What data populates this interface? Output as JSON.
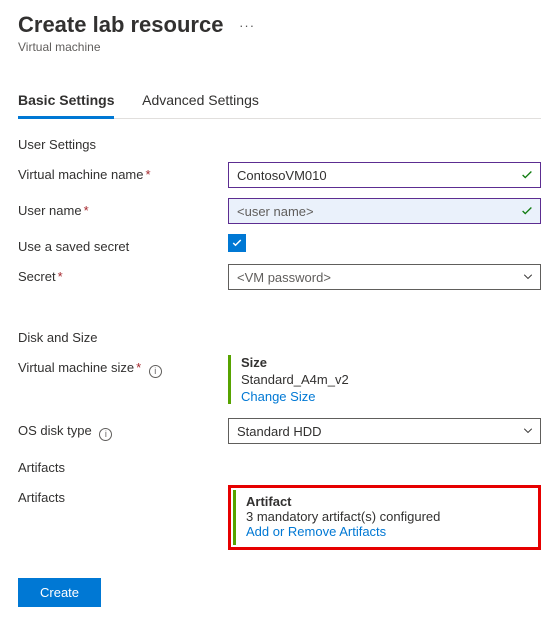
{
  "header": {
    "title": "Create lab resource",
    "subtitle": "Virtual machine"
  },
  "tabs": {
    "basic": "Basic Settings",
    "advanced": "Advanced Settings"
  },
  "sections": {
    "user": "User Settings",
    "disk": "Disk and Size",
    "artifacts": "Artifacts"
  },
  "fields": {
    "vm_name": {
      "label": "Virtual machine name",
      "value": "ContosoVM010"
    },
    "user_name": {
      "label": "User name",
      "placeholder": "<user name>"
    },
    "saved_secret": {
      "label": "Use a saved secret"
    },
    "secret": {
      "label": "Secret",
      "placeholder": "<VM password>"
    },
    "vm_size": {
      "label": "Virtual machine size",
      "title": "Size",
      "value": "Standard_A4m_v2",
      "change": "Change Size"
    },
    "os_disk": {
      "label": "OS disk type",
      "value": "Standard HDD"
    },
    "artifacts": {
      "label": "Artifacts",
      "title": "Artifact",
      "status": "3 mandatory artifact(s) configured",
      "link": "Add or Remove Artifacts"
    }
  },
  "buttons": {
    "create": "Create"
  }
}
